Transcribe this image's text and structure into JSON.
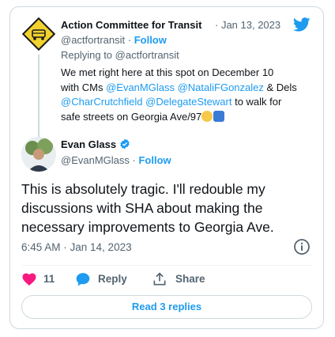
{
  "quoted": {
    "author_name": "Action Committee for Transit",
    "date": "· Jan 13, 2023",
    "handle": "@actfortransit",
    "follow_label": "Follow",
    "reply_prefix": "Replying to",
    "reply_handle": "@actfortransit",
    "line1": "We met right here at this spot on December 10",
    "line2_a": "with CMs",
    "mention1": "@EvanMGlass",
    "mention2": "@NataliFGonzalez",
    "line2_b": "& Dels",
    "mention3": "@CharCrutchfield",
    "mention4": "@DelegateStewart",
    "line3_b": "to walk for",
    "line4": "safe streets on Georgia Ave/97"
  },
  "main": {
    "author_name": "Evan Glass",
    "handle": "@EvanMGlass",
    "follow_label": "Follow",
    "text_line1": "This is absolutely tragic. I'll redouble my",
    "text_line2": "discussions with SHA about making the",
    "text_line3": "necessary improvements to Georgia Ave.",
    "timestamp": "6:45 AM · Jan 14, 2023"
  },
  "actions": {
    "like_count": "11",
    "reply_label": "Reply",
    "share_label": "Share"
  },
  "read_replies_label": "Read 3 replies",
  "colors": {
    "accent": "#1d9bf0",
    "like": "#f91880",
    "verified": "#1d9bf0",
    "logo_yellow": "#f2d22e"
  },
  "icons": [
    "twitter-bird-icon",
    "verified-badge-icon",
    "info-icon",
    "heart-icon",
    "reply-bubble-icon",
    "share-icon",
    "worried-face-emoji",
    "keycap-5-emoji"
  ]
}
